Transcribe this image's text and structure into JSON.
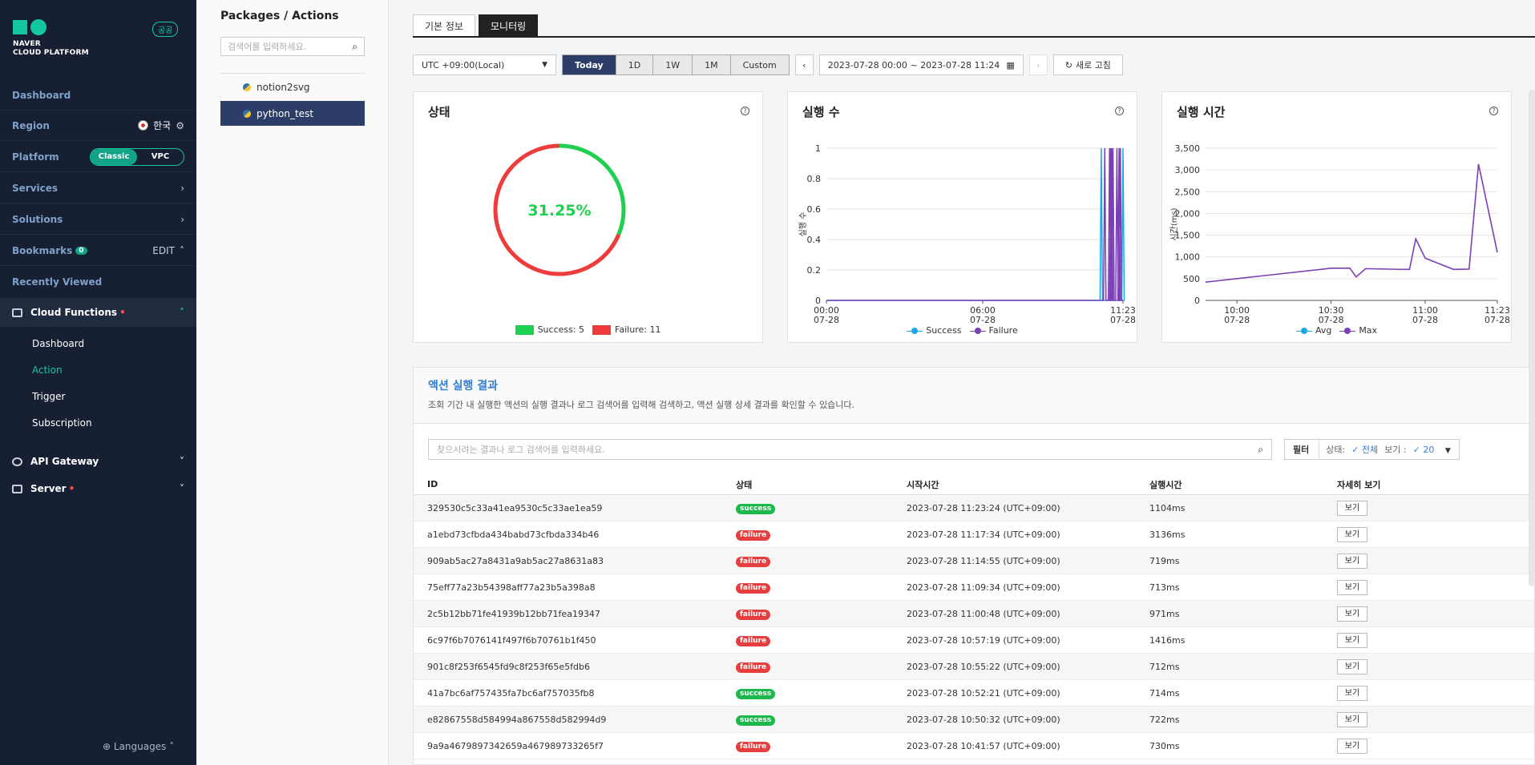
{
  "sidebar": {
    "brand_line1": "NAVER",
    "brand_line2": "CLOUD PLATFORM",
    "lang_badge": "공공",
    "dashboard": "Dashboard",
    "region_label": "Region",
    "region_value": "한국",
    "platform_label": "Platform",
    "platform_options": [
      "Classic",
      "VPC"
    ],
    "services": "Services",
    "solutions": "Solutions",
    "bookmarks": "Bookmarks",
    "bookmarks_count": "0",
    "bookmarks_edit": "EDIT",
    "recently_viewed": "Recently Viewed",
    "cloud_functions": "Cloud Functions",
    "sub_items": [
      "Dashboard",
      "Action",
      "Trigger",
      "Subscription"
    ],
    "active_sub": "Action",
    "api_gateway": "API Gateway",
    "server": "Server",
    "languages": "Languages"
  },
  "packages": {
    "title": "Packages / Actions",
    "search_placeholder": "검색어를 입력하세요.",
    "items": [
      "notion2svg",
      "python_test"
    ],
    "selected": "python_test"
  },
  "tabs": [
    "기본 정보",
    "모니터링"
  ],
  "active_tab": "모니터링",
  "toolbar": {
    "timezone": "UTC +09:00(Local)",
    "ranges": [
      "Today",
      "1D",
      "1W",
      "1M",
      "Custom"
    ],
    "active_range": "Today",
    "date_range": "2023-07-28 00:00 ~ 2023-07-28 11:24",
    "refresh": "새로 고침"
  },
  "cards": {
    "status": {
      "title": "상태"
    },
    "exec_count": {
      "title": "실행 수",
      "ylabel": "실행 수"
    },
    "exec_time": {
      "title": "실행 시간",
      "ylabel": "시간(ms)"
    }
  },
  "chart_data": [
    {
      "type": "pie",
      "title": "상태",
      "center_label": "31.25%",
      "slices": [
        {
          "label": "Success",
          "value": 5,
          "color": "#1fcf4f"
        },
        {
          "label": "Failure",
          "value": 11,
          "color": "#ee3b3b"
        }
      ],
      "legend": [
        "Success: 5",
        "Failure: 11"
      ]
    },
    {
      "type": "line",
      "title": "실행 수",
      "ylabel": "실행 수",
      "ylim": [
        0,
        1
      ],
      "yticks": [
        "0",
        "0.2",
        "0.4",
        "0.6",
        "0.8",
        "1"
      ],
      "xticks": [
        {
          "time": "00:00",
          "date": "07-28"
        },
        {
          "time": "06:00",
          "date": "07-28"
        },
        {
          "time": "11:23",
          "date": "07-28"
        }
      ],
      "series": [
        {
          "name": "Success",
          "color": "#1aa7e8",
          "spikes": [
            "10:33",
            "11:23"
          ]
        },
        {
          "name": "Failure",
          "color": "#7a3fb5",
          "spikes": [
            "10:41",
            "10:52",
            "10:55",
            "10:57",
            "11:00",
            "11:09",
            "11:14",
            "11:17"
          ]
        }
      ],
      "legend_position": "bottom"
    },
    {
      "type": "line",
      "title": "실행 시간",
      "ylabel": "시간(ms)",
      "ylim": [
        0,
        3500
      ],
      "yticks": [
        "0",
        "500",
        "1,000",
        "1,500",
        "2,000",
        "2,500",
        "3,000",
        "3,500"
      ],
      "xticks": [
        {
          "time": "10:00",
          "date": "07-28"
        },
        {
          "time": "10:30",
          "date": "07-28"
        },
        {
          "time": "11:00",
          "date": "07-28"
        },
        {
          "time": "11:23",
          "date": "07-28"
        }
      ],
      "series": [
        {
          "name": "Avg",
          "color": "#1aa7e8"
        },
        {
          "name": "Max",
          "color": "#7a3fb5",
          "points": [
            [
              "09:50",
              420
            ],
            [
              "10:10",
              580
            ],
            [
              "10:30",
              740
            ],
            [
              "10:36",
              740
            ],
            [
              "10:38",
              540
            ],
            [
              "10:41",
              730
            ],
            [
              "10:52",
              714
            ],
            [
              "10:55",
              712
            ],
            [
              "10:57",
              1416
            ],
            [
              "11:00",
              971
            ],
            [
              "11:09",
              713
            ],
            [
              "11:14",
              719
            ],
            [
              "11:17",
              3136
            ],
            [
              "11:23",
              1104
            ]
          ]
        }
      ],
      "legend_position": "bottom"
    }
  ],
  "results": {
    "title": "액션 실행 결과",
    "description": "조회 기간 내 실행한 액션의 실행 결과나 로그 검색어를 입력해 검색하고, 액션 실행 상세 결과를 확인할 수 있습니다.",
    "search_placeholder": "찾으시려는 결과나 로그 검색어를 입력하세요.",
    "filter_label": "필터",
    "status_label": "상태:",
    "status_value": "전체",
    "view_label": "보기 :",
    "view_value": "20",
    "columns": [
      "ID",
      "상태",
      "시작시간",
      "실행시간",
      "자세히 보기"
    ],
    "view_btn": "보기",
    "rows": [
      {
        "id": "329530c5c33a41ea9530c5c33ae1ea59",
        "status": "success",
        "start": "2023-07-28 11:23:24 (UTC+09:00)",
        "duration": "1104ms"
      },
      {
        "id": "a1ebd73cfbda434babd73cfbda334b46",
        "status": "failure",
        "start": "2023-07-28 11:17:34 (UTC+09:00)",
        "duration": "3136ms"
      },
      {
        "id": "909ab5ac27a8431a9ab5ac27a8631a83",
        "status": "failure",
        "start": "2023-07-28 11:14:55 (UTC+09:00)",
        "duration": "719ms"
      },
      {
        "id": "75eff77a23b54398aff77a23b5a398a8",
        "status": "failure",
        "start": "2023-07-28 11:09:34 (UTC+09:00)",
        "duration": "713ms"
      },
      {
        "id": "2c5b12bb71fe41939b12bb71fea19347",
        "status": "failure",
        "start": "2023-07-28 11:00:48 (UTC+09:00)",
        "duration": "971ms"
      },
      {
        "id": "6c97f6b7076141f497f6b70761b1f450",
        "status": "failure",
        "start": "2023-07-28 10:57:19 (UTC+09:00)",
        "duration": "1416ms"
      },
      {
        "id": "901c8f253f6545fd9c8f253f65e5fdb6",
        "status": "failure",
        "start": "2023-07-28 10:55:22 (UTC+09:00)",
        "duration": "712ms"
      },
      {
        "id": "41a7bc6af757435fa7bc6af757035fb8",
        "status": "success",
        "start": "2023-07-28 10:52:21 (UTC+09:00)",
        "duration": "714ms"
      },
      {
        "id": "e82867558d584994a867558d582994d9",
        "status": "success",
        "start": "2023-07-28 10:50:32 (UTC+09:00)",
        "duration": "722ms"
      },
      {
        "id": "9a9a4679897342659a467989733265f7",
        "status": "failure",
        "start": "2023-07-28 10:41:57 (UTC+09:00)",
        "duration": "730ms"
      }
    ]
  }
}
